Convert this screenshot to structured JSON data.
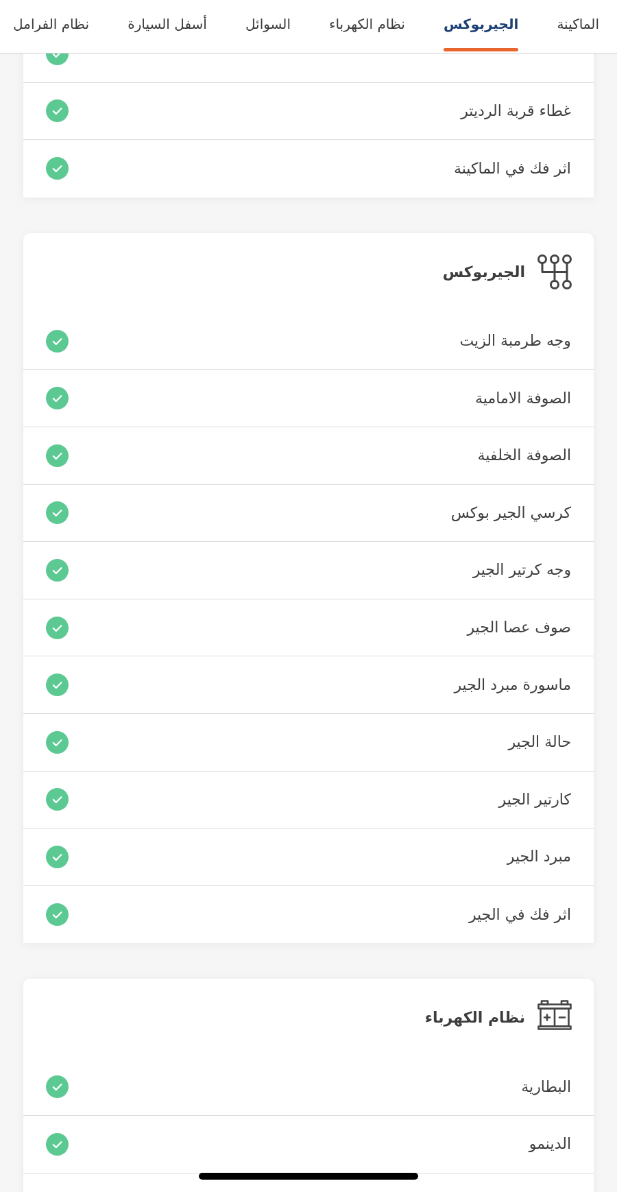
{
  "tabs": [
    {
      "label": "الماكينة",
      "selected": false
    },
    {
      "label": "الجيربوكس",
      "selected": true
    },
    {
      "label": "نظام الكهرباء",
      "selected": false
    },
    {
      "label": "السوائل",
      "selected": false
    },
    {
      "label": "أسفل السيارة",
      "selected": false
    },
    {
      "label": "نظام الفرامل",
      "selected": false
    }
  ],
  "sections": [
    {
      "items": [
        {
          "checked": true
        },
        {
          "label": "غطاء قربة الرديتر",
          "checked": true
        },
        {
          "label": "اثر فك في الماكينة",
          "checked": true
        }
      ]
    },
    {
      "kind": "gearbox",
      "title": "الجيربوكس",
      "items": [
        {
          "label": "وجه طرمبة الزيت",
          "checked": true
        },
        {
          "label": "الصوفة الامامية",
          "checked": true
        },
        {
          "label": "الصوفة الخلفية",
          "checked": true
        },
        {
          "label": "كرسي الجير بوكس",
          "checked": true
        },
        {
          "label": "وجه كرتير الجير",
          "checked": true
        },
        {
          "label": "صوف عصا الجير",
          "checked": true
        },
        {
          "label": "ماسورة مبرد الجير",
          "checked": true
        },
        {
          "label": "حالة الجير",
          "checked": true
        },
        {
          "label": "كارتير الجير",
          "checked": true
        },
        {
          "label": "مبرد الجير",
          "checked": true
        },
        {
          "label": "اثر فك في الجير",
          "checked": true
        }
      ]
    },
    {
      "kind": "electrical",
      "title": "نظام الكهرباء",
      "items": [
        {
          "label": "البطارية",
          "checked": true
        },
        {
          "label": "الدينمو",
          "checked": true
        }
      ]
    }
  ]
}
